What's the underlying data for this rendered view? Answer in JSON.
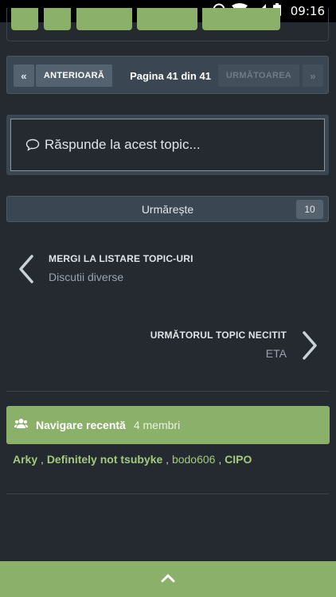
{
  "status_bar": {
    "time": "09:16"
  },
  "pagination": {
    "first": "«",
    "prev": "ANTERIOARĂ",
    "label": "Pagina 41 din 41",
    "next": "URMĂTOAREA",
    "last": "»"
  },
  "reply": {
    "placeholder": "Răspunde la acest topic..."
  },
  "follow": {
    "label": "Urmărește",
    "count": "10"
  },
  "nav_back": {
    "title": "MERGI LA LISTARE TOPIC-URI",
    "subtitle": "Discutii diverse"
  },
  "nav_next": {
    "title": "URMĂTORUL TOPIC NECITIT",
    "subtitle": "ETA"
  },
  "recent": {
    "title": "Navigare recentă",
    "count": "4 membri",
    "members": [
      "Arky",
      "Definitely not tsubyke",
      "bodo606",
      "CIPO"
    ],
    "separator": " , "
  },
  "colors": {
    "accent": "#8bb06a",
    "background": "#252a31",
    "panel": "#3a4652"
  }
}
